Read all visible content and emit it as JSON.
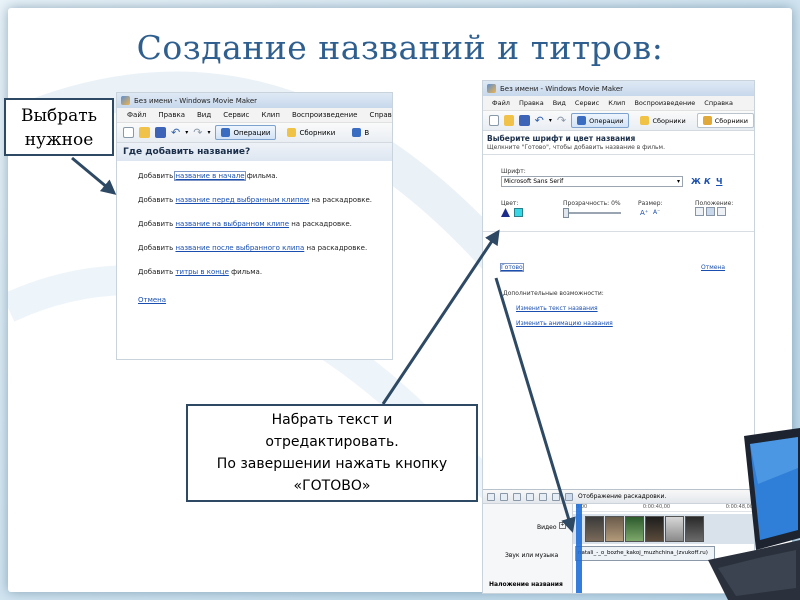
{
  "slide": {
    "title": "Создание названий и титров:"
  },
  "callouts": {
    "select": {
      "line1": "Выбрать",
      "line2": "нужное"
    },
    "type": {
      "line1": "Набрать текст  и",
      "line2": "отредактировать.",
      "line3": "По завершении нажать кнопку",
      "line4": "«ГОТОВО»"
    }
  },
  "left_window": {
    "title": "Без имени - Windows Movie Maker",
    "menu": [
      "Файл",
      "Правка",
      "Вид",
      "Сервис",
      "Клип",
      "Воспроизведение",
      "Справ"
    ],
    "toolbar": {
      "tasks": "Операции",
      "collections": "Сборники",
      "trailing": "В"
    },
    "panel_title": "Где добавить название?",
    "options": [
      {
        "prefix": "Добавить ",
        "link": "название в начале",
        "suffix": " фильма."
      },
      {
        "prefix": "Добавить ",
        "link": "название перед выбранным клипом",
        "suffix": " на раскадровке."
      },
      {
        "prefix": "Добавить ",
        "link": "название на выбранном клипе",
        "suffix": " на раскадровке."
      },
      {
        "prefix": "Добавить ",
        "link": "название после выбранного клипа",
        "suffix": " на раскадровке."
      },
      {
        "prefix": "Добавить ",
        "link": "титры в конце",
        "suffix": " фильма."
      }
    ],
    "cancel": "Отмена"
  },
  "right_window": {
    "title": "Без имени - Windows Movie Maker",
    "menu": [
      "Файл",
      "Правка",
      "Вид",
      "Сервис",
      "Клип",
      "Воспроизведение",
      "Справка"
    ],
    "toolbar": {
      "tasks": "Операции",
      "collections": "Сборники",
      "collection_name": "Сборники"
    },
    "header_title": "Выберите шрифт и цвет названия",
    "header_sub": "Щелкните \"Готово\", чтобы добавить название в фильм.",
    "font_label": "Шрифт:",
    "font_value": "Microsoft Sans Serif",
    "format_buttons": [
      "Ж",
      "К",
      "Ч"
    ],
    "color_label": "Цвет:",
    "transparency_label": "Прозрачность:",
    "transparency_value": "0%",
    "transparency_fraction": 0,
    "size_label": "Размер:",
    "position_label": "Положение:",
    "done": "Готово",
    "cancel": "Отмена",
    "extra_label": "Дополнительные возможности:",
    "extra_links": [
      "Изменить текст названия",
      "Изменить анимацию названия"
    ],
    "timeline": {
      "storyboard": "Отображение раскадровки.",
      "tracks": [
        "Видео",
        "Звук или музыка",
        "Наложение названия"
      ],
      "ruler": [
        "0:00",
        "0:00:40,00",
        "0:00:48,00"
      ],
      "audio_clip": "natali_-_o_bozhe_kakoj_muzhchina_(zvukoff.ru)"
    }
  },
  "colors": {
    "title": "#2f5f8f",
    "link": "#1a4fb0",
    "arrow": "#2d4964",
    "color_swatch_a": "#1c2c8a",
    "color_swatch_b": "#38d7e6"
  }
}
